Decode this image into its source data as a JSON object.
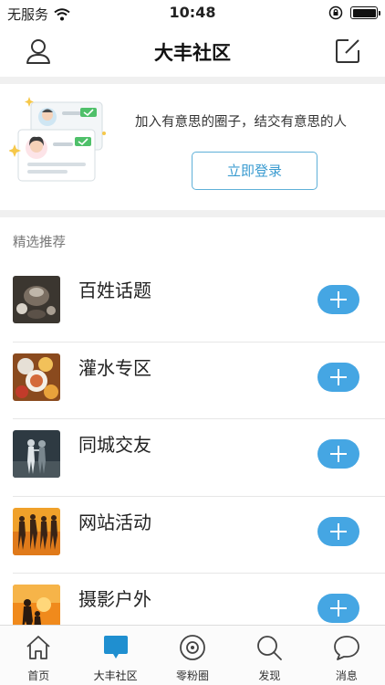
{
  "status_bar": {
    "carrier": "无服务",
    "time": "10:48",
    "wifi_icon": "wifi-icon",
    "orientation_lock_icon": "orientation-lock-icon",
    "battery_icon": "battery-icon"
  },
  "nav": {
    "title": "大丰社区",
    "left_icon": "user-icon",
    "right_icon": "compose-icon"
  },
  "banner": {
    "tagline": "加入有意思的圈子，结交有意思的人",
    "login_label": "立即登录"
  },
  "section": {
    "label": "精选推荐"
  },
  "communities": [
    {
      "title": "百姓话题",
      "thumb": "tea-set-photo"
    },
    {
      "title": "灌水专区",
      "thumb": "food-photo"
    },
    {
      "title": "同城交友",
      "thumb": "couple-photo"
    },
    {
      "title": "网站活动",
      "thumb": "dancers-photo"
    },
    {
      "title": "摄影户外",
      "thumb": "sunset-photo"
    }
  ],
  "tabs": [
    {
      "label": "首页",
      "icon": "home-icon",
      "active": false
    },
    {
      "label": "大丰社区",
      "icon": "chat-bubble-icon",
      "active": true
    },
    {
      "label": "零粉圈",
      "icon": "circle-icon",
      "active": false
    },
    {
      "label": "发现",
      "icon": "search-icon",
      "active": false
    },
    {
      "label": "消息",
      "icon": "message-icon",
      "active": false
    }
  ],
  "colors": {
    "accent": "#45a6e3",
    "active_tab": "#1f8fd0",
    "login_border": "#5fb0d8"
  }
}
